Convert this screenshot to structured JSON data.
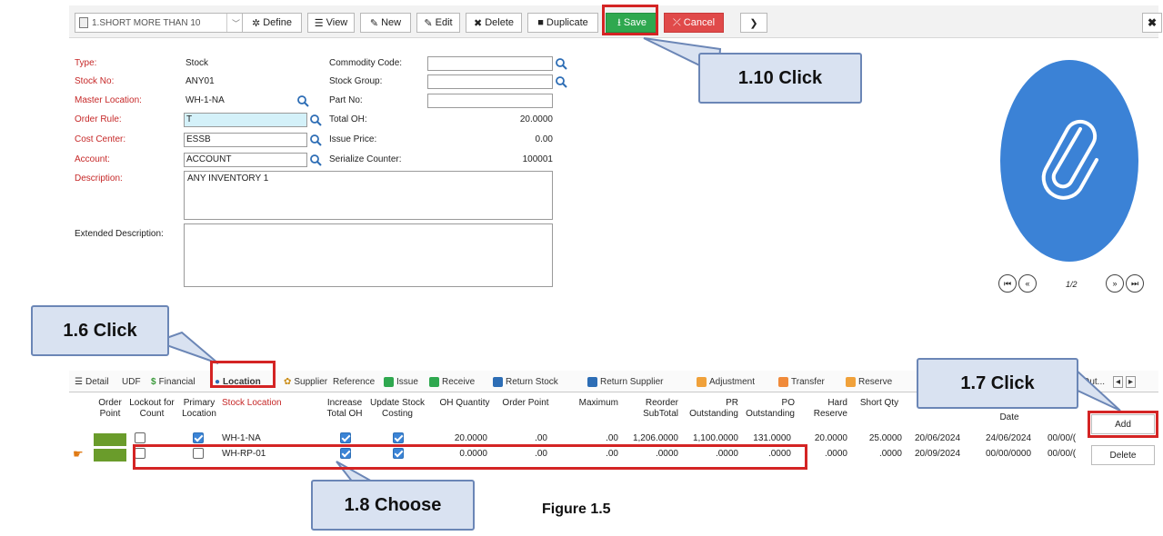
{
  "toolbar": {
    "selector_value": "1.SHORT MORE THAN 10",
    "buttons": {
      "define": "Define",
      "view": "View",
      "new": "New",
      "edit": "Edit",
      "delete": "Delete",
      "duplicate": "Duplicate",
      "save": "Save",
      "cancel": "Cancel"
    },
    "close": "✖"
  },
  "form": {
    "left": [
      {
        "label": "Type:",
        "value": "Stock"
      },
      {
        "label": "Stock No:",
        "value": "ANY01"
      },
      {
        "label": "Master Location:",
        "value": "WH-1-NA"
      },
      {
        "label": "Order Rule:",
        "value": "T"
      },
      {
        "label": "Cost Center:",
        "value": "ESSB"
      },
      {
        "label": "Account:",
        "value": "ACCOUNT"
      },
      {
        "label": "Description:",
        "value": "ANY INVENTORY 1"
      },
      {
        "label": "Extended Description:",
        "value": ""
      }
    ],
    "right": [
      {
        "label": "Commodity Code:",
        "value": ""
      },
      {
        "label": "Stock Group:",
        "value": ""
      },
      {
        "label": "Part No:",
        "value": ""
      },
      {
        "label": "Total OH:",
        "value": "20.0000"
      },
      {
        "label": "Issue Price:",
        "value": "0.00"
      },
      {
        "label": "Serialize Counter:",
        "value": "100001"
      }
    ]
  },
  "image_panel": {
    "pager": "1/2",
    "accent": "#3b82d6"
  },
  "tabs": [
    {
      "label": "Detail"
    },
    {
      "label": "UDF"
    },
    {
      "label": "Financial"
    },
    {
      "label": "Location"
    },
    {
      "label": "Supplier"
    },
    {
      "label": "Reference"
    },
    {
      "label": "Issue"
    },
    {
      "label": "Receive"
    },
    {
      "label": "Return Stock"
    },
    {
      "label": "Return Supplier"
    },
    {
      "label": "Adjustment"
    },
    {
      "label": "Transfer"
    },
    {
      "label": "Reserve"
    },
    {
      "label": "O Out..."
    }
  ],
  "grid": {
    "headers": {
      "order_point": "Order Point",
      "lockout": "Lockout for Count",
      "primary": "Primary Location",
      "stock_location": "Stock Location",
      "increase_oh": "Increase Total OH",
      "update_costing": "Update Stock Costing",
      "oh_qty": "OH Quantity",
      "order_point2": "Order Point",
      "maximum": "Maximum",
      "reorder_subtotal": "Reorder SubTotal",
      "pr_outstanding": "PR Outstanding",
      "po_outstanding": "PO Outstanding",
      "hard_reserve": "Hard Reserve",
      "short_qty": "Short Qty",
      "date": "Date"
    },
    "rows": [
      {
        "lockout": false,
        "primary": true,
        "location": "WH-1-NA",
        "increase": true,
        "update": true,
        "oh_qty": "20.0000",
        "order_point": ".00",
        "maximum": ".00",
        "reorder": "1,206.0000",
        "pr": "1,100.0000",
        "po": "131.0000",
        "hard": "20.0000",
        "short": "25.0000",
        "date1": "20/06/2024",
        "date2": "24/06/2024",
        "date3": "00/00/("
      },
      {
        "lockout": false,
        "primary": false,
        "location": "WH-RP-01",
        "increase": true,
        "update": true,
        "oh_qty": "0.0000",
        "order_point": ".00",
        "maximum": ".00",
        "reorder": ".0000",
        "pr": ".0000",
        "po": ".0000",
        "hard": ".0000",
        "short": ".0000",
        "date1": "20/09/2024",
        "date2": "00/00/0000",
        "date3": "00/00/("
      }
    ],
    "add_label": "Add",
    "delete_label": "Delete"
  },
  "annotations": {
    "c110": "1.10 Click",
    "c16": "1.6 Click",
    "c17": "1.7 Click",
    "c18": "1.8 Choose",
    "caption": "Figure 1.5"
  },
  "colors": {
    "required_label": "#c62828",
    "save_green": "#2fa84f",
    "cancel_red": "#e04a4a",
    "annotation_red": "#d42424",
    "callout_fill": "#d9e2f1"
  }
}
